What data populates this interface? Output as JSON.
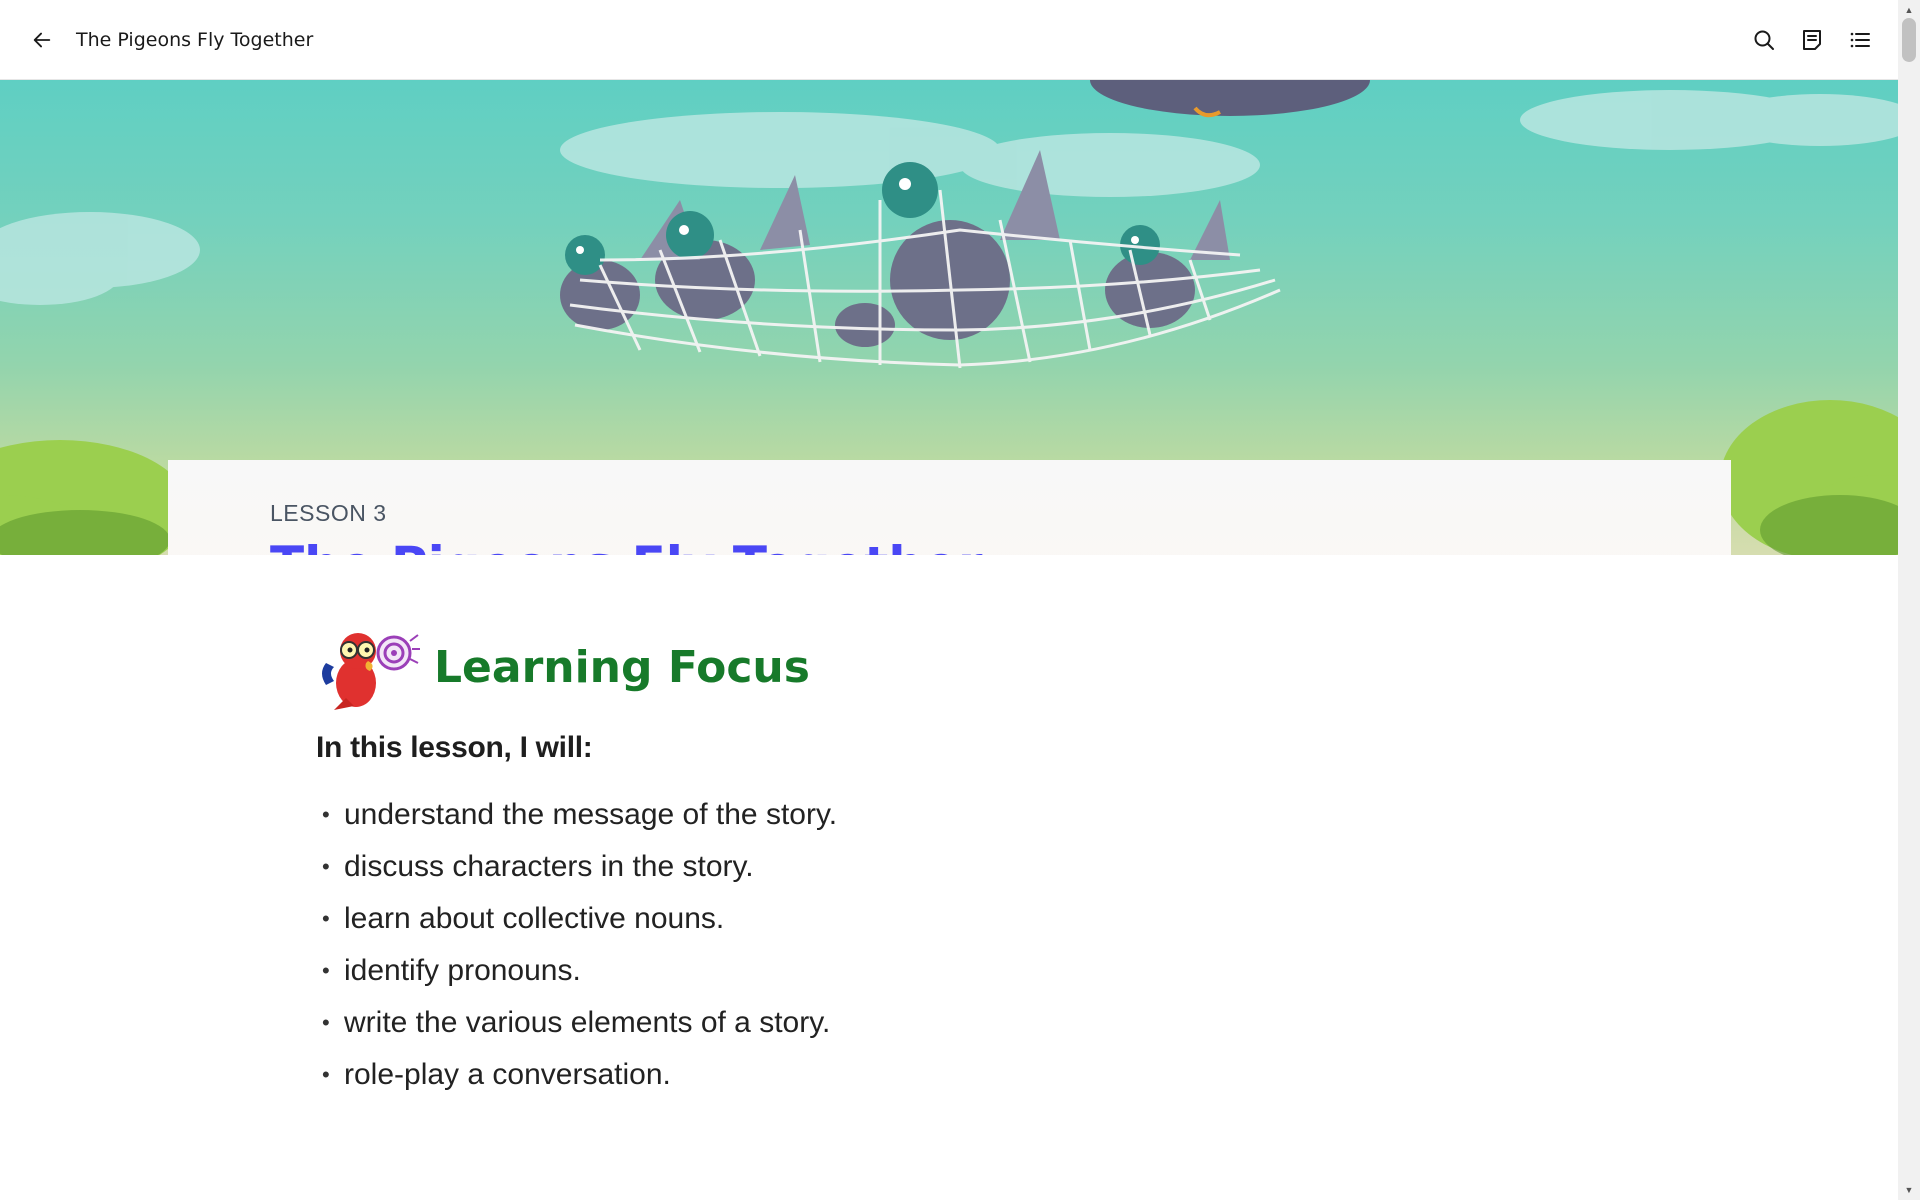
{
  "topbar": {
    "back_icon": "arrow-left-icon",
    "title": "The Pigeons Fly Together",
    "actions": [
      {
        "name": "search-icon"
      },
      {
        "name": "notes-icon"
      },
      {
        "name": "table-of-contents-icon"
      }
    ]
  },
  "hero": {
    "lesson_label": "LESSON 3",
    "lesson_title": "The Pigeons Fly Together",
    "colors": {
      "sky": "#5fcfc3",
      "bush": "#9bcf4f",
      "pigeon": "#6d7089",
      "net": "#ffffff"
    }
  },
  "learning_focus": {
    "mascot_icon": "parrot-mascot-icon",
    "heading": "Learning Focus",
    "intro": "In this lesson, I will:",
    "items": [
      "understand the message of the story.",
      "discuss characters in the story.",
      "learn about collective nouns.",
      "identify pronouns.",
      "write the various elements of a story.",
      "role-play a conversation."
    ]
  },
  "colors": {
    "title_blue": "#4a47f5",
    "heading_green": "#177a2a",
    "label_gray": "#4a5563"
  }
}
